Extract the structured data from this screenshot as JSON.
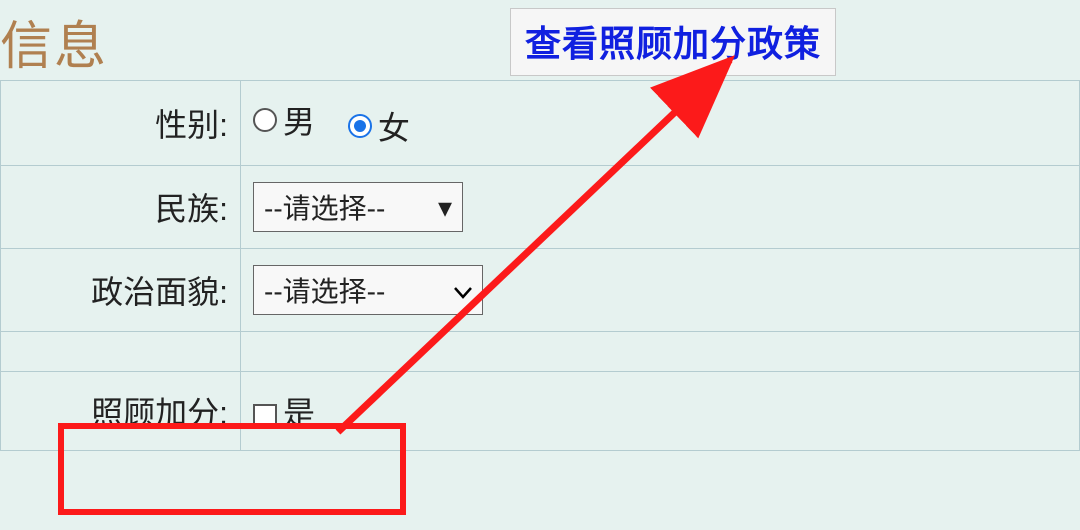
{
  "header": {
    "title_partial": "信息",
    "policy_link_label": "查看照顾加分政策"
  },
  "fields": {
    "gender": {
      "label_char1": "性",
      "label_char2": "别",
      "colon": ":",
      "options": {
        "male": "男",
        "female": "女"
      },
      "selected": "female"
    },
    "ethnicity": {
      "label_char1": "民",
      "label_char2": "族",
      "colon": ":",
      "placeholder": "--请选择--"
    },
    "political": {
      "label": "政治面貌",
      "colon": ":",
      "placeholder": "--请选择--"
    },
    "bonus": {
      "label": "照顾加分",
      "colon": ":",
      "option_yes": "是",
      "checked": false
    }
  },
  "annotation": {
    "highlight_color": "#fc1a1a",
    "arrow_color": "#fc1a1a"
  }
}
